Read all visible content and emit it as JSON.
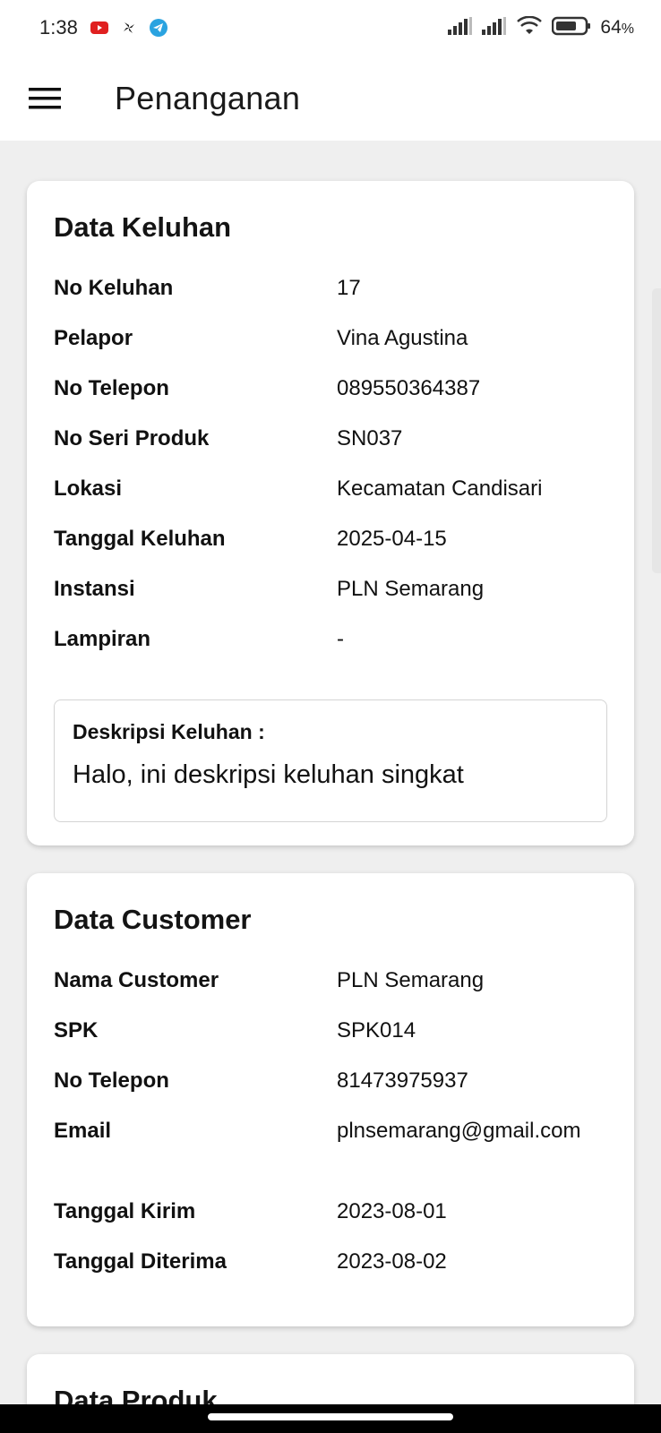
{
  "status_bar": {
    "time": "1:38",
    "notifications": [
      "youtube-icon",
      "pinwheel-icon",
      "telegram-icon"
    ],
    "battery_percent": "64",
    "battery_unit": "%"
  },
  "app_bar": {
    "title": "Penanganan",
    "menu_icon": "hamburger-menu-icon"
  },
  "keluhan": {
    "title": "Data Keluhan",
    "rows": [
      {
        "label": "No Keluhan",
        "value": "17"
      },
      {
        "label": "Pelapor",
        "value": "Vina Agustina"
      },
      {
        "label": "No Telepon",
        "value": "089550364387"
      },
      {
        "label": "No Seri Produk",
        "value": "SN037"
      },
      {
        "label": "Lokasi",
        "value": "Kecamatan Candisari"
      },
      {
        "label": "Tanggal Keluhan",
        "value": "2025-04-15"
      },
      {
        "label": "Instansi",
        "value": "PLN Semarang"
      },
      {
        "label": "Lampiran",
        "value": "-"
      }
    ],
    "description_label": "Deskripsi Keluhan :",
    "description": "Halo, ini deskripsi keluhan singkat"
  },
  "customer": {
    "title": "Data Customer",
    "rows": [
      {
        "label": "Nama Customer",
        "value": "PLN Semarang"
      },
      {
        "label": "SPK",
        "value": "SPK014"
      },
      {
        "label": "No Telepon",
        "value": "81473975937"
      },
      {
        "label": "Email",
        "value": "plnsemarang@gmail.com"
      },
      {
        "label": "Tanggal Kirim",
        "value": "2023-08-01"
      },
      {
        "label": "Tanggal Diterima",
        "value": "2023-08-02"
      }
    ]
  },
  "produk": {
    "title": "Data Produk"
  },
  "colors": {
    "background": "#efefef",
    "card": "#ffffff",
    "text": "#111111"
  }
}
